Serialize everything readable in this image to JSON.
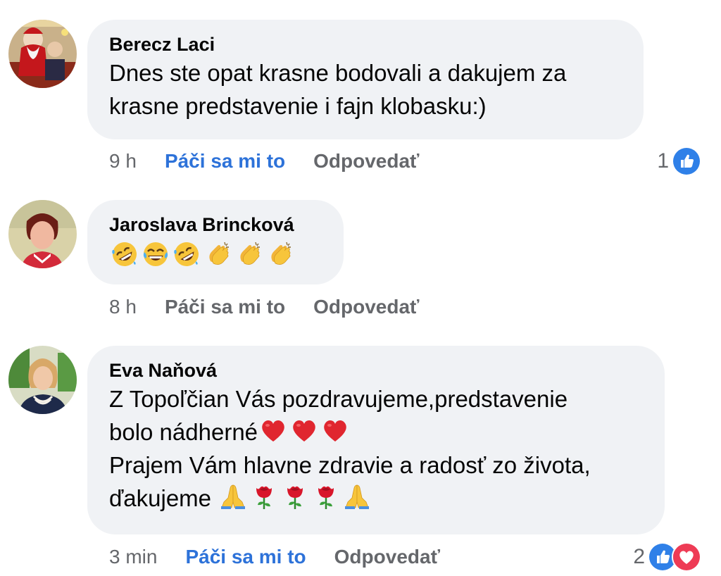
{
  "comments": [
    {
      "author": "Berecz Laci",
      "lines": [
        "Dnes ste opat krasne bodovali a dakujem za",
        "krasne predstavenie i fajn klobasku:)"
      ],
      "time": "9 h",
      "like_label": "Páči sa mi to",
      "liked": true,
      "reply_label": "Odpovedať",
      "reaction_count": "1",
      "reactions": [
        "like-icon"
      ]
    },
    {
      "author": "Jaroslava Brincková",
      "emojis": [
        "rofl-emoji",
        "joy-emoji",
        "rofl-emoji",
        "clap-emoji",
        "clap-emoji",
        "clap-emoji"
      ],
      "time": "8 h",
      "like_label": "Páči sa mi to",
      "liked": false,
      "reply_label": "Odpovedať"
    },
    {
      "author": "Eva Naňová",
      "line1": "Z Topoľčian Vás pozdravujeme,predstavenie",
      "line2": "bolo nádherné",
      "line2_emojis": [
        "heart-emoji",
        "heart-emoji",
        "heart-emoji"
      ],
      "line3": "Prajem Vám hlavne zdravie a radosť zo života,",
      "line4": "ďakujeme",
      "line4_emojis": [
        "pray-emoji",
        "rose-emoji",
        "rose-emoji",
        "rose-emoji",
        "pray-emoji"
      ],
      "time": "3 min",
      "like_label": "Páči sa mi to",
      "liked": true,
      "reply_label": "Odpovedať",
      "reaction_count": "2",
      "reactions": [
        "like-icon",
        "love-icon"
      ]
    }
  ],
  "colors": {
    "bubble": "#f0f2f5",
    "liked_blue": "#2d72d9",
    "meta_gray": "#65676b",
    "text": "#050505"
  }
}
